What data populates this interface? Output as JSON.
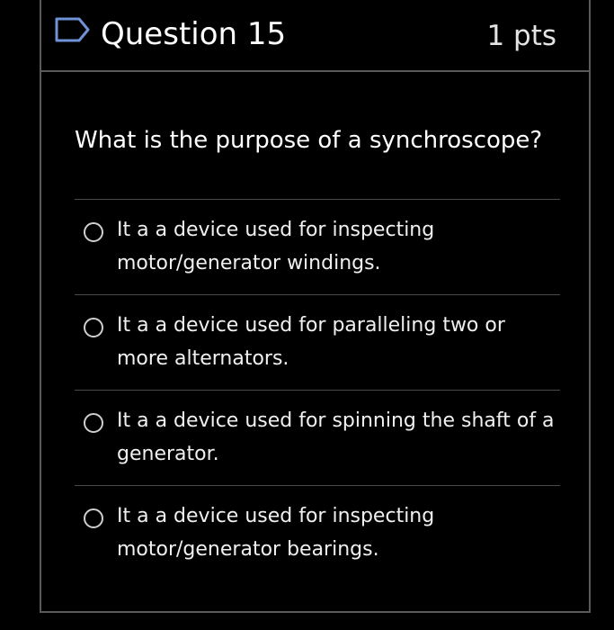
{
  "question": {
    "title": "Question 15",
    "points": "1 pts",
    "prompt": "What is the purpose of a synchroscope?",
    "flag_icon": "flag-outline-icon"
  },
  "answers": [
    {
      "label": "It a a device used for inspecting motor/generator windings.",
      "selected": false
    },
    {
      "label": "It a a device used for paralleling two or more alternators.",
      "selected": false
    },
    {
      "label": "It a a device used for spinning the shaft of a generator.",
      "selected": false
    },
    {
      "label": "It a a device used for inspecting motor/generator bearings.",
      "selected": false
    }
  ],
  "colors": {
    "background": "#000000",
    "border": "#5a5a5a",
    "divider": "#4a4a4a",
    "text": "#f2f2f2"
  }
}
